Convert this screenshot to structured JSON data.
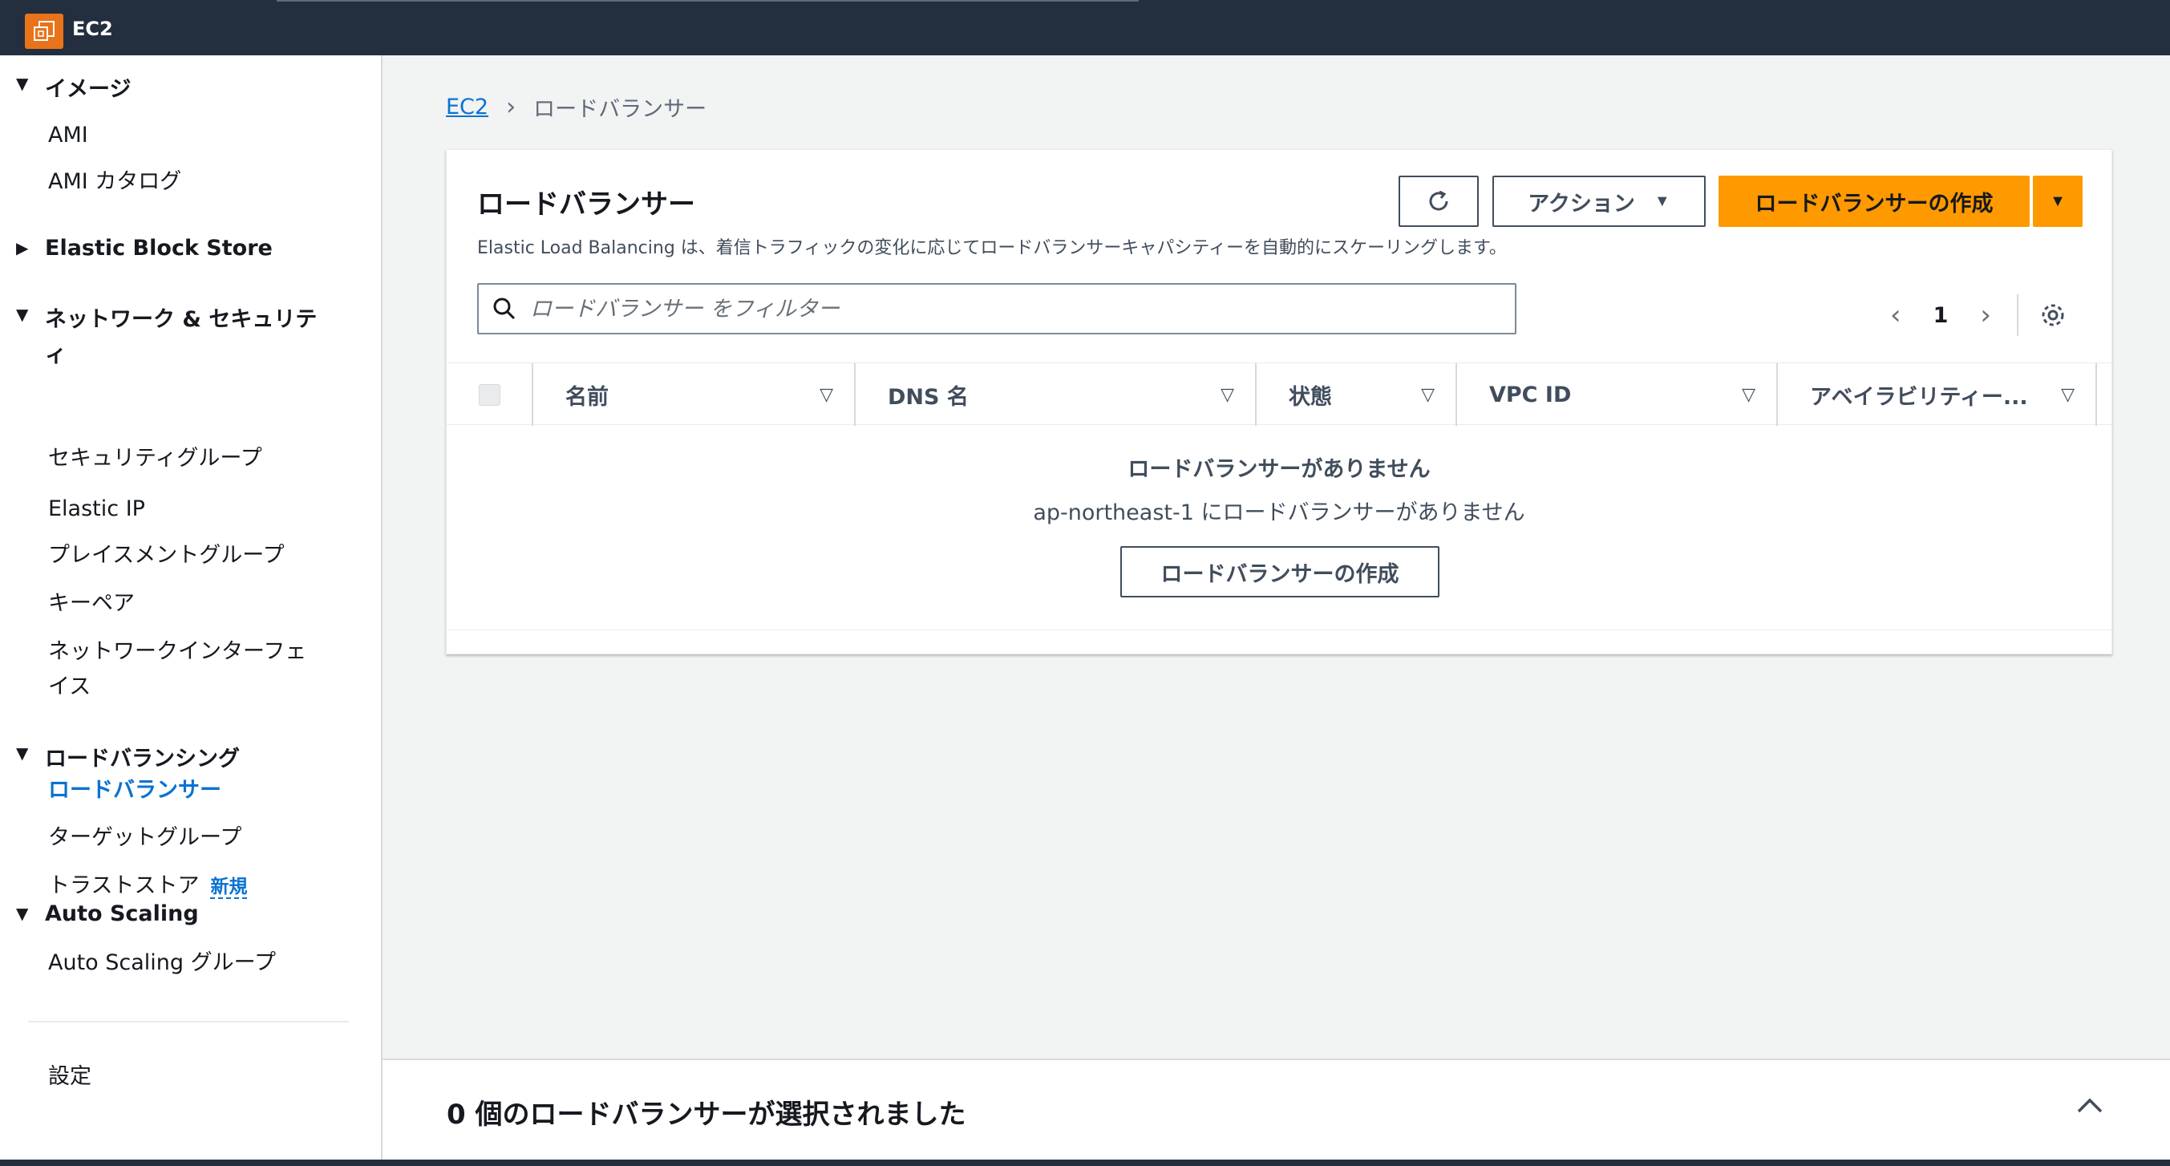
{
  "topbar": {
    "service_name": "EC2"
  },
  "sidebar": {
    "sections": [
      {
        "label": "イメージ",
        "expanded": true,
        "items": [
          "AMI",
          "AMI カタログ"
        ]
      },
      {
        "label": "Elastic Block Store",
        "expanded": false,
        "items": []
      },
      {
        "label_line1": "ネットワーク & セキュリテ",
        "label_line2": "ィ",
        "expanded": true,
        "items": [
          "セキュリティグループ",
          "Elastic IP",
          "プレイスメントグループ",
          "キーペア"
        ],
        "multiline_item": {
          "line1": "ネットワークインターフェ",
          "line2": "イス"
        }
      },
      {
        "label": "ロードバランシング",
        "expanded": true,
        "items": [
          "ロードバランサー",
          "ターゲットグループ",
          "トラストストア"
        ],
        "new_badge": "新規"
      },
      {
        "label": "Auto Scaling",
        "expanded": true,
        "items": [
          "Auto Scaling グループ"
        ]
      }
    ],
    "settings": "設定"
  },
  "breadcrumb": {
    "root": "EC2",
    "current": "ロードバランサー"
  },
  "panel": {
    "title": "ロードバランサー",
    "description": "Elastic Load Balancing は、着信トラフィックの変化に応じてロードバランサーキャパシティーを自動的にスケーリングします。",
    "actions_label": "アクション",
    "create_label": "ロードバランサーの作成",
    "filter_placeholder": "ロードバランサー をフィルター",
    "page_number": "1"
  },
  "table": {
    "columns": [
      "名前",
      "DNS 名",
      "状態",
      "VPC ID",
      "アベイラビリティー..."
    ],
    "empty_title": "ロードバランサーがありません",
    "empty_desc": "ap-northeast-1 にロードバランサーがありません",
    "empty_button": "ロードバランサーの作成"
  },
  "split_panel": {
    "title": "0 個のロードバランサーが選択されました"
  },
  "colors": {
    "topbar": "#232f3e",
    "primary": "#ff9900",
    "link": "#0972d3",
    "service_icon": "#e8731a"
  }
}
